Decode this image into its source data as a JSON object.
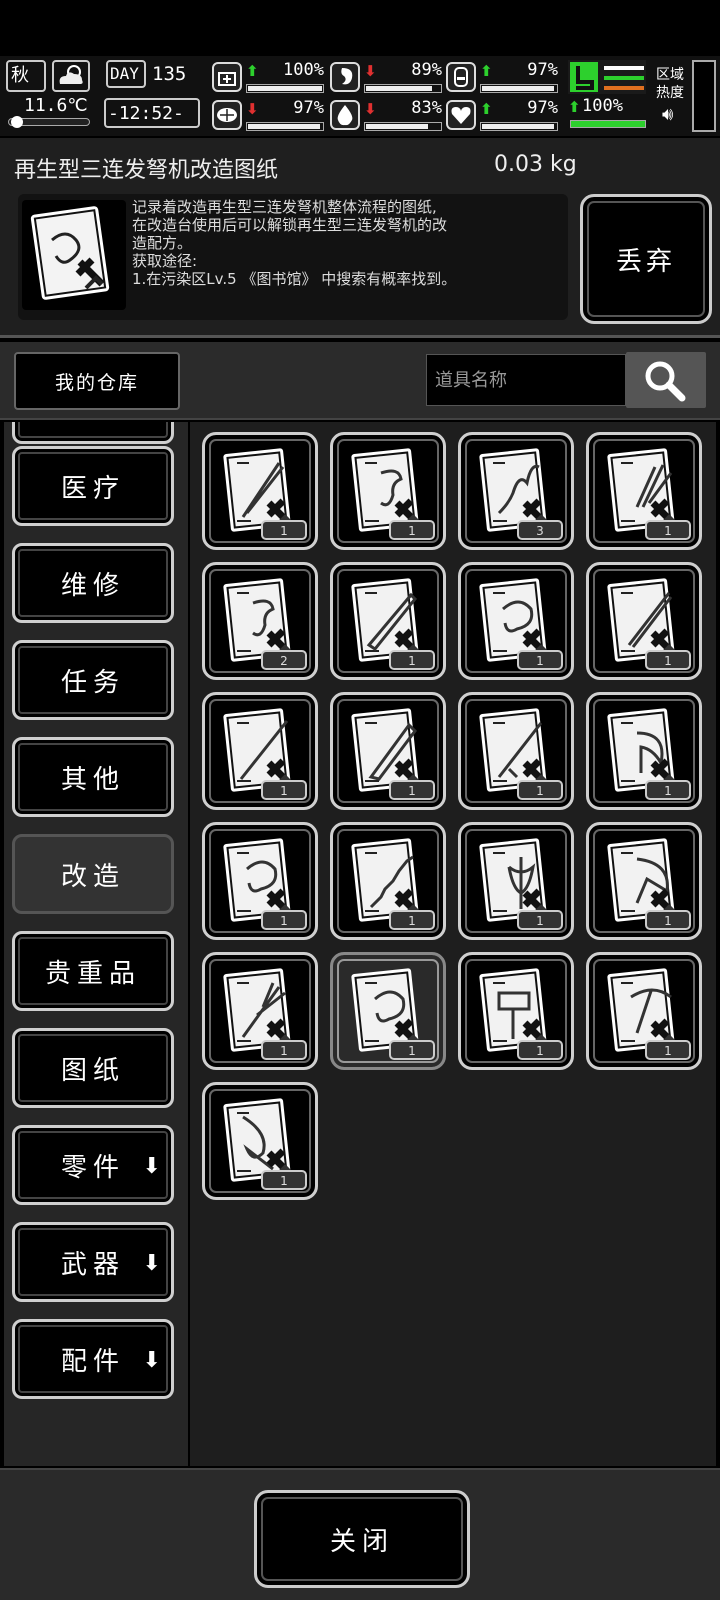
{
  "status": {
    "season": "秋",
    "temperature": "11.6℃",
    "day_label": "DAY",
    "day": "135",
    "time": "-12:52-",
    "stats": [
      {
        "name": "health",
        "icon": "medkit-icon",
        "arrow": "up",
        "value": "100%",
        "level": 1.0
      },
      {
        "name": "hunger",
        "icon": "stomach-icon",
        "arrow": "down",
        "value": "89%",
        "level": 0.89
      },
      {
        "name": "energy",
        "icon": "battery-icon",
        "arrow": "up",
        "value": "97%",
        "level": 0.97
      },
      {
        "name": "sanity",
        "icon": "brain-icon",
        "arrow": "down",
        "value": "97%",
        "level": 0.97
      },
      {
        "name": "thirst",
        "icon": "water-drop-icon",
        "arrow": "down",
        "value": "83%",
        "level": 0.83
      },
      {
        "name": "mood",
        "icon": "heart-icon",
        "arrow": "up",
        "value": "97%",
        "level": 0.97
      }
    ],
    "stamina": {
      "arrow": "up",
      "value": "100%",
      "level": 1.0
    },
    "zone_label": "区域\n热度"
  },
  "item": {
    "title": "再生型三连发弩机改造图纸",
    "weight": "0.03 kg",
    "description": "记录着改造再生型三连发弩机整体流程的图纸,\n在改造台使用后可以解锁再生型三连发弩机的改\n造配方。\n获取途径:\n1.在污染区Lv.5 《图书馆》 中搜索有概率找到。",
    "discard_label": "丢弃"
  },
  "toolbar": {
    "storage_label": "我的仓库",
    "search_placeholder": "道具名称"
  },
  "categories": [
    {
      "label": "医疗",
      "selected": false,
      "expand": false
    },
    {
      "label": "维修",
      "selected": false,
      "expand": false
    },
    {
      "label": "任务",
      "selected": false,
      "expand": false
    },
    {
      "label": "其他",
      "selected": false,
      "expand": false
    },
    {
      "label": "改造",
      "selected": true,
      "expand": false
    },
    {
      "label": "贵重品",
      "selected": false,
      "expand": false
    },
    {
      "label": "图纸",
      "selected": false,
      "expand": false
    },
    {
      "label": "零件",
      "selected": false,
      "expand": true
    },
    {
      "label": "武器",
      "selected": false,
      "expand": true
    },
    {
      "label": "配件",
      "selected": false,
      "expand": true
    }
  ],
  "items": [
    {
      "icon": "blueprint-blade-icon",
      "count": "1"
    },
    {
      "icon": "blueprint-trigger-icon",
      "count": "1"
    },
    {
      "icon": "blueprint-chain-icon",
      "count": "3"
    },
    {
      "icon": "blueprint-claw-icon",
      "count": "1"
    },
    {
      "icon": "blueprint-trigger-icon",
      "count": "2"
    },
    {
      "icon": "blueprint-saw-blade-icon",
      "count": "1"
    },
    {
      "icon": "blueprint-crossbow-icon",
      "count": "1"
    },
    {
      "icon": "blueprint-knife-icon",
      "count": "1"
    },
    {
      "icon": "blueprint-spear-icon",
      "count": "1"
    },
    {
      "icon": "blueprint-machete-icon",
      "count": "1"
    },
    {
      "icon": "blueprint-sword-icon",
      "count": "1"
    },
    {
      "icon": "blueprint-scythe-icon",
      "count": "1"
    },
    {
      "icon": "blueprint-crossbow-icon",
      "count": "1"
    },
    {
      "icon": "blueprint-serrated-blade-icon",
      "count": "1"
    },
    {
      "icon": "blueprint-axe-icon",
      "count": "1"
    },
    {
      "icon": "blueprint-cleaver-icon",
      "count": "1"
    },
    {
      "icon": "blueprint-trident-icon",
      "count": "1"
    },
    {
      "icon": "blueprint-crossbow-icon",
      "count": "1",
      "selected": true
    },
    {
      "icon": "blueprint-hammer-icon",
      "count": "1"
    },
    {
      "icon": "blueprint-pickaxe-icon",
      "count": "1"
    },
    {
      "icon": "blueprint-battleaxe-icon",
      "count": "1"
    }
  ],
  "close_label": "关闭"
}
